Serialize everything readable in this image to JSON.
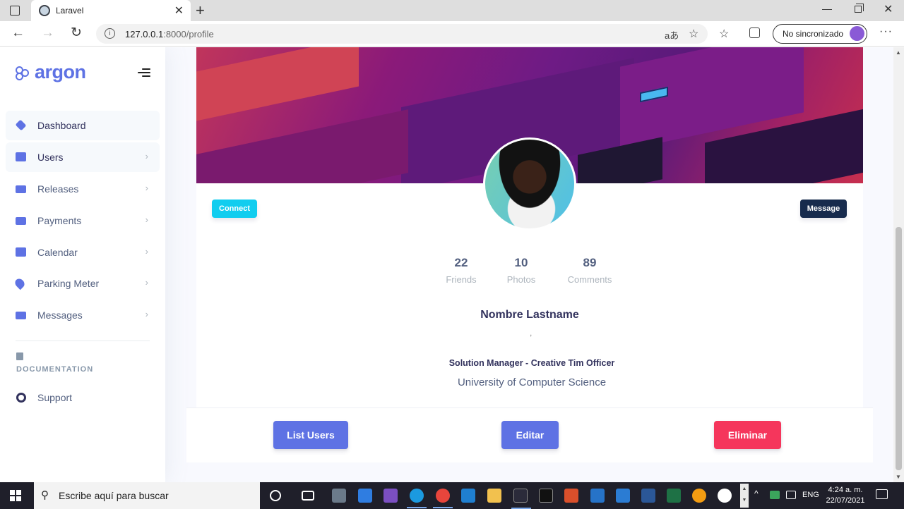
{
  "browser": {
    "tab_title": "Laravel",
    "url_host": "127.0.0.1",
    "url_rest": ":8000/profile",
    "sync_label": "No sincronizado"
  },
  "sidebar": {
    "brand": "argon",
    "items": [
      {
        "label": "Dashboard",
        "icon": "cube-icon",
        "color": "#5e72e4",
        "active": true,
        "arrow": false
      },
      {
        "label": "Users",
        "icon": "building-icon",
        "color": "#5e72e4",
        "active": true,
        "arrow": true
      },
      {
        "label": "Releases",
        "icon": "mail-icon",
        "color": "#5e72e4",
        "arrow": true
      },
      {
        "label": "Payments",
        "icon": "credit-card-icon",
        "color": "#5e72e4",
        "arrow": true
      },
      {
        "label": "Calendar",
        "icon": "calendar-icon",
        "color": "#5e72e4",
        "arrow": true
      },
      {
        "label": "Parking Meter",
        "icon": "pin-icon",
        "color": "#5e72e4",
        "arrow": true
      },
      {
        "label": "Messages",
        "icon": "mail-icon",
        "color": "#5e72e4",
        "arrow": true
      }
    ],
    "doc_heading": "DOCUMENTATION",
    "support_label": "Support"
  },
  "profile": {
    "connect_label": "Connect",
    "message_label": "Message",
    "stats": [
      {
        "value": "22",
        "label": "Friends"
      },
      {
        "value": "10",
        "label": "Photos"
      },
      {
        "value": "89",
        "label": "Comments"
      }
    ],
    "name": "Nombre Lastname",
    "separator": ",",
    "job": "Solution Manager - Creative Tim Officer",
    "university": "University of Computer Science"
  },
  "actions": {
    "list_users": "List Users",
    "edit": "Editar",
    "delete": "Eliminar"
  },
  "taskbar": {
    "search_placeholder": "Escribe aquí para buscar",
    "language": "ENG",
    "time": "4:24 a. m.",
    "date": "22/07/2021"
  },
  "colors": {
    "primary": "#5e72e4",
    "info": "#11cdef",
    "default": "#172b4d",
    "danger": "#f5365c"
  }
}
